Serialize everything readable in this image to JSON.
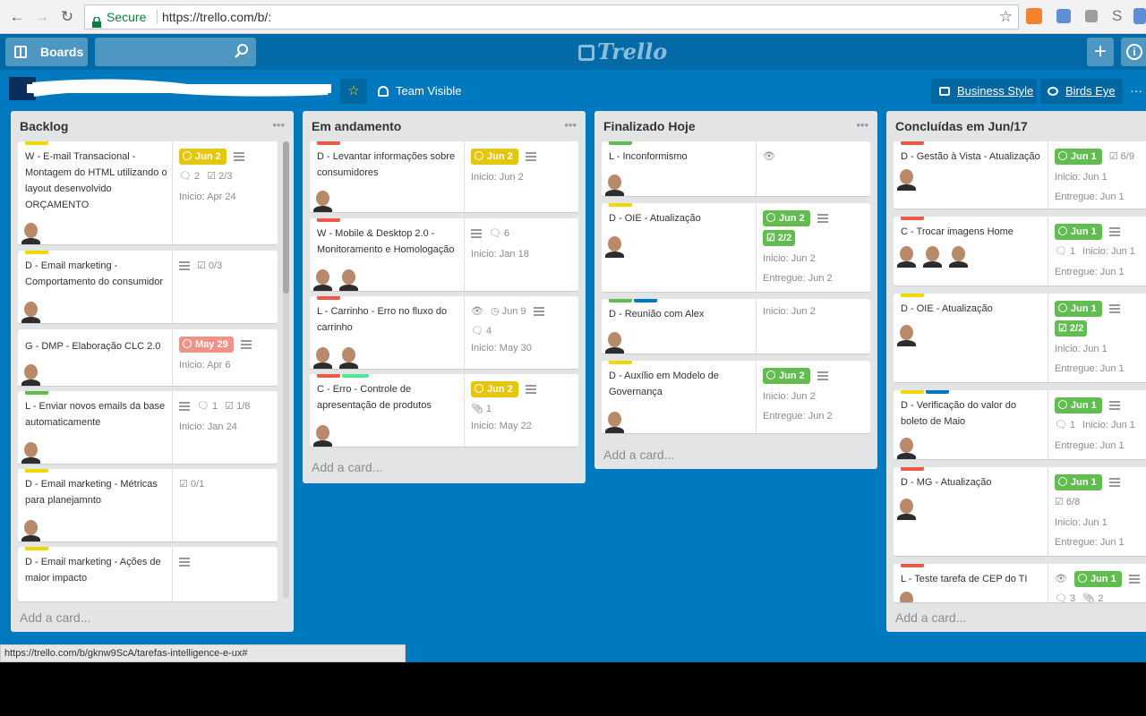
{
  "browser": {
    "secure_label": "Secure",
    "url": "https://trello.com/b/:",
    "status_url": "https://trello.com/b/gknw9ScA/tarefas-intelligence-e-ux#"
  },
  "topbar": {
    "boards_label": "Boards",
    "logo_text": "Trello",
    "plus_label": "+",
    "info_label": "i"
  },
  "board_header": {
    "visibility_label": "Team Visible",
    "business_label": "Business Style",
    "birds_label": "Birds Eye",
    "more_label": "···"
  },
  "colors": {
    "board_bg": "#0079bf",
    "label_yellow": "#f2d600",
    "label_green": "#61bd4f",
    "label_red": "#eb5a46",
    "label_blue": "#0079bf",
    "label_lightgreen": "#51e898"
  },
  "lists": [
    {
      "title": "Backlog",
      "add_label": "Add a card...",
      "cards": [
        {
          "labels": [
            "yellow"
          ],
          "title": "W - E-mail Transacional - Montagem do HTML utilizando o layout desenvolvido ORÇAMENTO",
          "due": "Jun 2",
          "due_color": "yellow",
          "desc": true,
          "comments": "2",
          "checklist": "2/3",
          "lines": [
            "Inicio: Apr 24"
          ]
        },
        {
          "labels": [
            "yellow"
          ],
          "title": "D - Email marketing - Comportamento do consumidor",
          "desc": true,
          "checklist": "0/3",
          "lines": []
        },
        {
          "labels": [],
          "title": "G - DMP - Elaboração CLC 2.0",
          "due": "May 29",
          "due_color": "red",
          "desc": true,
          "lines": [
            "Inicio: Apr 6"
          ]
        },
        {
          "labels": [
            "green"
          ],
          "title": "L -          Enviar novos emails da base automaticamente",
          "desc": true,
          "comments": "1",
          "checklist": "1/8",
          "lines": [
            "Inicio: Jan 24"
          ]
        },
        {
          "labels": [
            "yellow"
          ],
          "title": "D - Email marketing - Métricas para planejamnto",
          "checklist": "0/1",
          "lines": []
        },
        {
          "labels": [
            "yellow"
          ],
          "title": "D - Email marketing - Ações de maior impacto",
          "desc": true,
          "lines": []
        }
      ]
    },
    {
      "title": "Em andamento",
      "add_label": "Add a card...",
      "cards": [
        {
          "labels": [
            "red"
          ],
          "title": "D - Levantar informações sobre consumidores",
          "due": "Jun 2",
          "due_color": "yellow",
          "desc": true,
          "lines": [
            "Inicio: Jun 2"
          ]
        },
        {
          "labels": [
            "red"
          ],
          "title": "W - Mobile & Desktop 2.0 - Monitoramento e Homologação",
          "desc": true,
          "comments": "6",
          "lines": [
            "Inicio: Jan 18"
          ]
        },
        {
          "labels": [
            "red"
          ],
          "title": "L - Carrinho - Erro no fluxo do carrinho",
          "watch": true,
          "due": "Jun 9",
          "due_color": "plain",
          "desc": true,
          "comments": "4",
          "lines": [
            "Inicio: May 30"
          ]
        },
        {
          "labels": [
            "red",
            "lightgreen"
          ],
          "title": "C - Erro - Controle de apresentação de produtos",
          "due": "Jun 2",
          "due_color": "yellow",
          "desc": true,
          "attachments": "1",
          "lines": [
            "Inicio: May 22"
          ]
        }
      ]
    },
    {
      "title": "Finalizado Hoje",
      "add_label": "Add a card...",
      "cards": [
        {
          "labels": [
            "green"
          ],
          "title": "L - Inconformismo",
          "watch": true,
          "lines": []
        },
        {
          "labels": [
            "yellow"
          ],
          "title": "D - OIE - Atualização",
          "due": "Jun 2",
          "due_color": "green",
          "desc": true,
          "checklist_done": "2/2",
          "lines": [
            "Inicio: Jun 2",
            "Entregue: Jun 2"
          ]
        },
        {
          "labels": [
            "green",
            "blue"
          ],
          "title": "D - Reunião com Alex",
          "lines": [
            "Inicio: Jun 2"
          ]
        },
        {
          "labels": [
            "yellow"
          ],
          "title": "D - Auxílio em Modelo de Governança",
          "due": "Jun 2",
          "due_color": "green",
          "desc": true,
          "lines": [
            "Inicio: Jun 2",
            "Entregue: Jun 2"
          ]
        }
      ]
    },
    {
      "title": "Concluídas em Jun/17",
      "add_label": "Add a card...",
      "cards": [
        {
          "labels": [
            "red"
          ],
          "title": "D - Gestão à Vista - Atualização",
          "due": "Jun 1",
          "due_color": "green",
          "checklist": "6/9",
          "lines": [
            "Inicio: Jun 1",
            "Entregue: Jun 1"
          ]
        },
        {
          "labels": [
            "red"
          ],
          "title": "C - Trocar imagens Home",
          "due": "Jun 1",
          "due_color": "green",
          "desc": true,
          "comments": "1",
          "inline": "Inicio: Jun 1",
          "lines": [
            "Entregue: Jun 1"
          ]
        },
        {
          "labels": [
            "yellow"
          ],
          "title": "D - OIE - Atualização",
          "due": "Jun 1",
          "due_color": "green",
          "desc": true,
          "checklist_done": "2/2",
          "lines": [
            "Inicio: Jun 1",
            "Entregue: Jun 1"
          ]
        },
        {
          "labels": [
            "yellow",
            "blue"
          ],
          "title": "D            - Verificação do valor do boleto de Maio",
          "due": "Jun 1",
          "due_color": "green",
          "desc": true,
          "comments": "1",
          "inline": "Inicio: Jun 1",
          "lines": [
            "Entregue: Jun 1"
          ]
        },
        {
          "labels": [
            "red"
          ],
          "title": "D - MG - Atualização",
          "due": "Jun 1",
          "due_color": "green",
          "desc": true,
          "checklist": "6/8",
          "lines": [
            "Inicio: Jun 1",
            "Entregue: Jun 1"
          ]
        },
        {
          "labels": [
            "red"
          ],
          "title": "L - Teste tarefa de CEP do TI",
          "watch": true,
          "due": "Jun 1",
          "due_color": "green",
          "desc": true,
          "comments": "3",
          "attachments": "2",
          "lines": []
        }
      ]
    }
  ]
}
